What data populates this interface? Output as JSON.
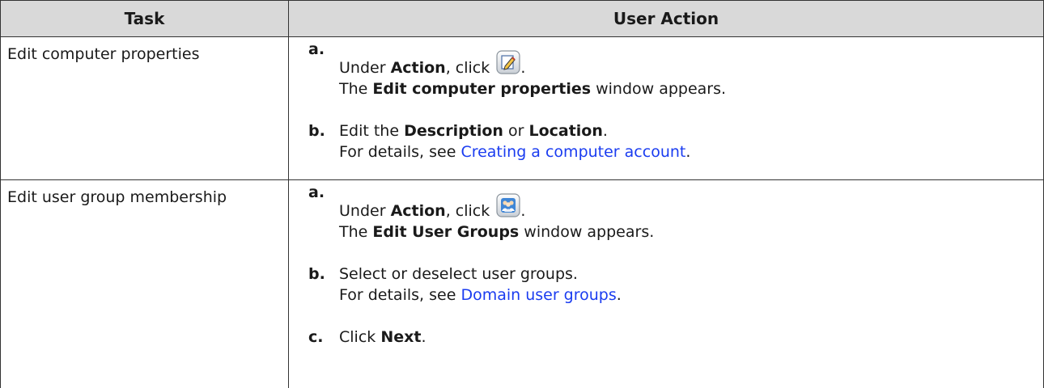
{
  "headers": {
    "task": "Task",
    "action": "User Action"
  },
  "rows": [
    {
      "task": "Edit computer properties",
      "steps": [
        {
          "marker": "a.",
          "line1_pre": "Under ",
          "line1_bold": "Action",
          "line1_post": ", click",
          "icon": "edit-pencil-icon",
          "line2_pre": "The ",
          "line2_bold": "Edit computer properties",
          "line2_post": " window appears."
        },
        {
          "marker": "b.",
          "line1_pre": "Edit the ",
          "line1_bold1": "Description",
          "line1_mid": " or ",
          "line1_bold2": "Location",
          "line1_post": ".",
          "line2_pre": "For details, see ",
          "line2_link": "Creating a computer account",
          "line2_post": "."
        }
      ]
    },
    {
      "task": "Edit user group membership",
      "steps": [
        {
          "marker": "a.",
          "line1_pre": "Under ",
          "line1_bold": "Action",
          "line1_post": ", click",
          "icon": "user-group-icon",
          "line2_pre": "The ",
          "line2_bold": "Edit User Groups",
          "line2_post": " window appears."
        },
        {
          "marker": "b.",
          "line1": "Select or deselect user groups.",
          "line2_pre": "For details, see ",
          "line2_link": "Domain user groups",
          "line2_post": "."
        },
        {
          "marker": "c.",
          "line1_pre": "Click ",
          "line1_bold": "Next",
          "line1_post": "."
        }
      ]
    }
  ]
}
